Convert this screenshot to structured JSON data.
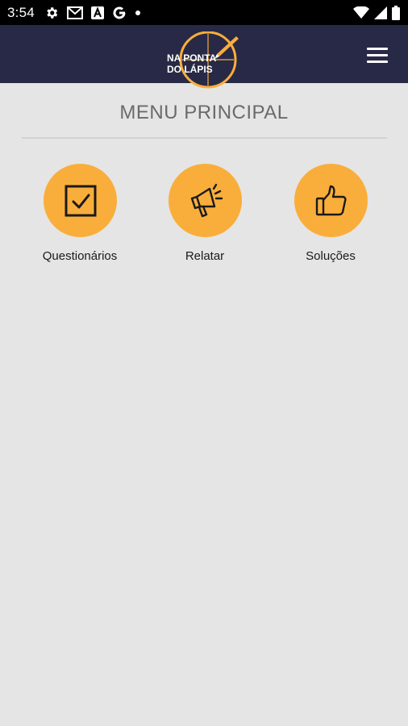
{
  "status_bar": {
    "time": "3:54",
    "left_icons": [
      "gear-icon",
      "gmail-icon",
      "a-icon",
      "google-icon",
      "dot-icon"
    ],
    "right_icons": [
      "wifi-icon",
      "signal-icon",
      "battery-icon"
    ]
  },
  "app_bar": {
    "logo_line1": "NA PONTA",
    "logo_line2": "DO LÁPIS",
    "background": "#282946"
  },
  "page": {
    "title": "MENU PRINCIPAL",
    "background": "#e5e5e5"
  },
  "menu": {
    "accent": "#f9ae3b",
    "items": [
      {
        "label": "Questionários",
        "icon": "checkbox-icon"
      },
      {
        "label": "Relatar",
        "icon": "megaphone-icon"
      },
      {
        "label": "Soluções",
        "icon": "thumbs-up-icon"
      }
    ]
  }
}
